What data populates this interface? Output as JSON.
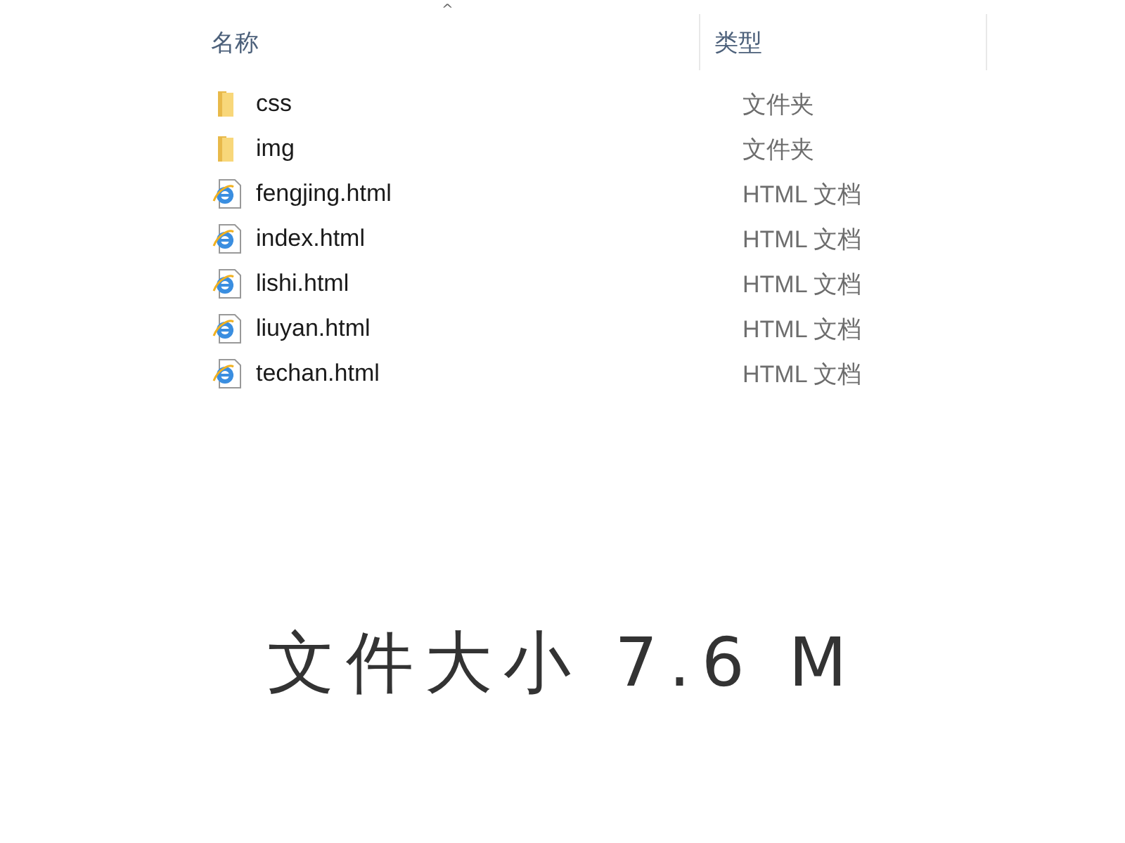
{
  "table": {
    "sort_indicator": "^",
    "columns": [
      "名称",
      "类型"
    ],
    "rows": [
      {
        "kind": "folder",
        "name": "css",
        "type": "文件夹"
      },
      {
        "kind": "folder",
        "name": "img",
        "type": "文件夹"
      },
      {
        "kind": "html",
        "name": "fengjing.html",
        "type": "HTML 文档"
      },
      {
        "kind": "html",
        "name": "index.html",
        "type": "HTML 文档"
      },
      {
        "kind": "html",
        "name": "lishi.html",
        "type": "HTML 文档"
      },
      {
        "kind": "html",
        "name": "liuyan.html",
        "type": "HTML 文档"
      },
      {
        "kind": "html",
        "name": "techan.html",
        "type": "HTML 文档"
      }
    ]
  },
  "caption": "文件大小 7.6 M"
}
